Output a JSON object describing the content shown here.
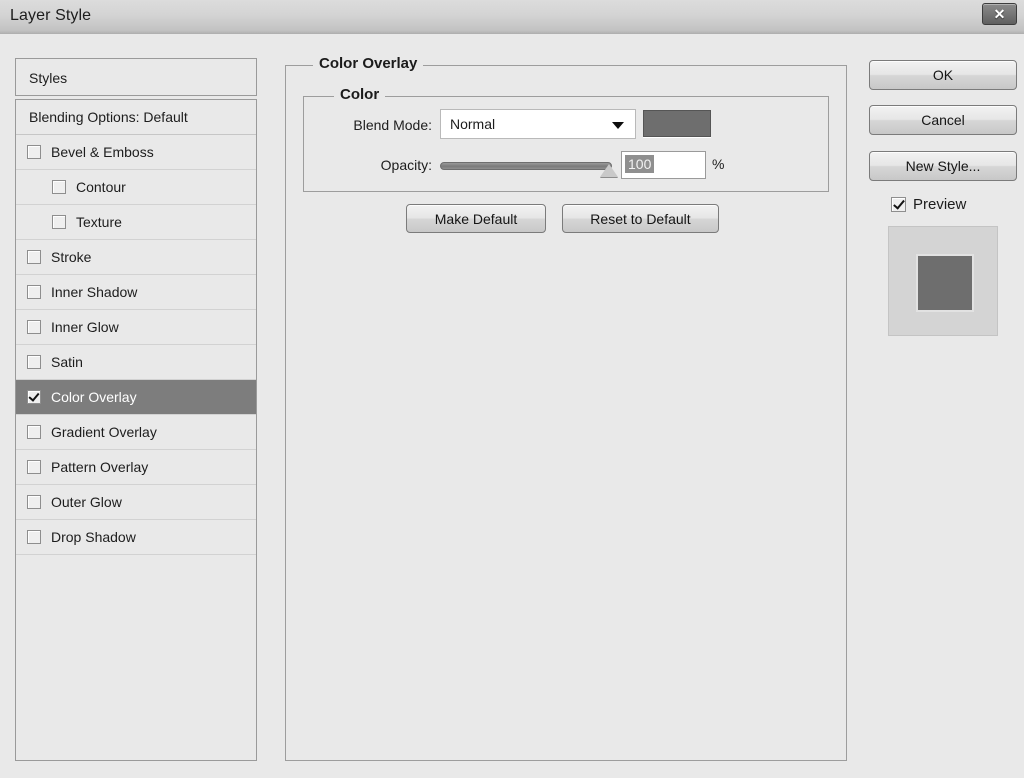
{
  "window": {
    "title": "Layer Style",
    "close_icon": "close-icon",
    "close_glyph": "✕"
  },
  "sidebar": {
    "header_label": "Styles",
    "items": [
      {
        "label": "Blending Options: Default",
        "has_checkbox": false,
        "checked": false,
        "indent": false,
        "selected": false
      },
      {
        "label": "Bevel & Emboss",
        "has_checkbox": true,
        "checked": false,
        "indent": false,
        "selected": false
      },
      {
        "label": "Contour",
        "has_checkbox": true,
        "checked": false,
        "indent": true,
        "selected": false
      },
      {
        "label": "Texture",
        "has_checkbox": true,
        "checked": false,
        "indent": true,
        "selected": false
      },
      {
        "label": "Stroke",
        "has_checkbox": true,
        "checked": false,
        "indent": false,
        "selected": false
      },
      {
        "label": "Inner Shadow",
        "has_checkbox": true,
        "checked": false,
        "indent": false,
        "selected": false
      },
      {
        "label": "Inner Glow",
        "has_checkbox": true,
        "checked": false,
        "indent": false,
        "selected": false
      },
      {
        "label": "Satin",
        "has_checkbox": true,
        "checked": false,
        "indent": false,
        "selected": false
      },
      {
        "label": "Color Overlay",
        "has_checkbox": true,
        "checked": true,
        "indent": false,
        "selected": true
      },
      {
        "label": "Gradient Overlay",
        "has_checkbox": true,
        "checked": false,
        "indent": false,
        "selected": false
      },
      {
        "label": "Pattern Overlay",
        "has_checkbox": true,
        "checked": false,
        "indent": false,
        "selected": false
      },
      {
        "label": "Outer Glow",
        "has_checkbox": true,
        "checked": false,
        "indent": false,
        "selected": false
      },
      {
        "label": "Drop Shadow",
        "has_checkbox": true,
        "checked": false,
        "indent": false,
        "selected": false
      }
    ]
  },
  "main": {
    "group_outer_title": "Color Overlay",
    "group_inner_title": "Color",
    "blend_mode": {
      "label": "Blend Mode:",
      "value": "Normal",
      "arrow_icon": "chevron-down-icon",
      "swatch_color": "#6e6e6e"
    },
    "opacity": {
      "label": "Opacity:",
      "value": "100",
      "unit": "%",
      "percent": 100
    },
    "buttons": {
      "make_default": "Make Default",
      "reset_to_default": "Reset to Default"
    }
  },
  "actions": {
    "ok": "OK",
    "cancel": "Cancel",
    "new_style": "New Style...",
    "preview_label": "Preview",
    "preview_checked": true
  },
  "preview": {
    "background_color": "#d4d4d4",
    "shape_color": "#6e6e6e"
  }
}
